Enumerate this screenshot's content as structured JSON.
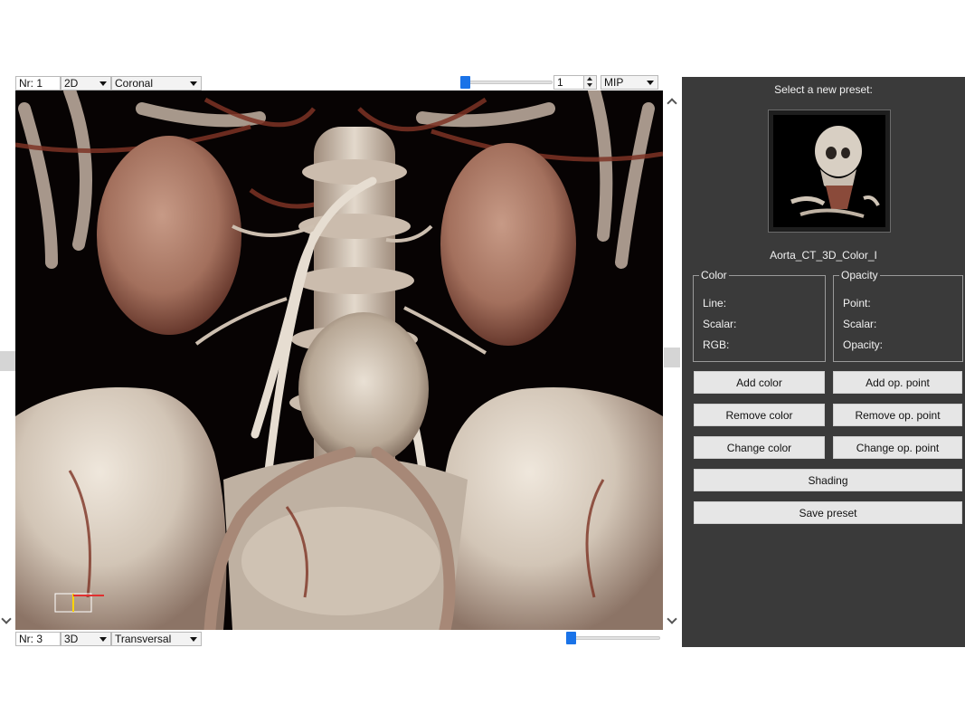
{
  "top_toolbar": {
    "nr_label": "Nr: 1",
    "mode": "2D",
    "orientation": "Coronal",
    "slice_value": "1",
    "render_mode": "MIP"
  },
  "bottom_toolbar": {
    "nr_label": "Nr: 3",
    "mode": "3D",
    "orientation": "Transversal"
  },
  "panel": {
    "title": "Select a new preset:",
    "preset_name": "Aorta_CT_3D_Color_I",
    "color_group": {
      "legend": "Color",
      "rows": [
        "Line:",
        "Scalar:",
        "RGB:"
      ]
    },
    "opacity_group": {
      "legend": "Opacity",
      "rows": [
        "Point:",
        "Scalar:",
        "Opacity:"
      ]
    },
    "buttons": {
      "add_color": "Add color",
      "add_op_point": "Add op. point",
      "remove_color": "Remove color",
      "remove_op_point": "Remove op. point",
      "change_color": "Change color",
      "change_op_point": "Change op. point",
      "shading": "Shading",
      "save_preset": "Save preset"
    }
  },
  "colors": {
    "panel_bg": "#3a3a3a",
    "slider_accent": "#1a73e8",
    "viewport_bg": "#070303",
    "bone": "#d9cfc2",
    "vessel": "#8a3d2c"
  }
}
